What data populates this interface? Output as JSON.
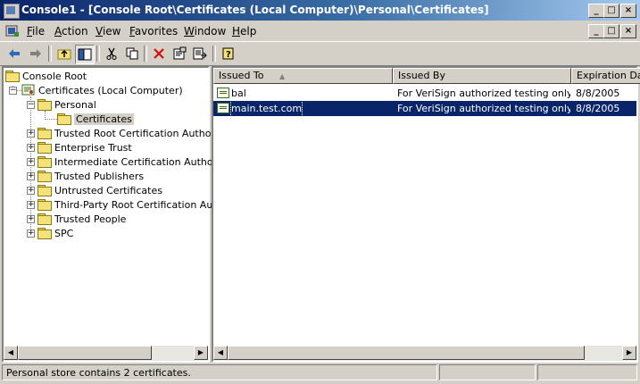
{
  "window": {
    "title": "Console1 - [Console Root\\Certificates (Local Computer)\\Personal\\Certificates]",
    "caption_buttons": [
      "_",
      "□",
      "×"
    ],
    "mdi_buttons": [
      "_",
      "□",
      "×"
    ]
  },
  "menu": {
    "items": [
      "File",
      "Action",
      "View",
      "Favorites",
      "Window",
      "Help"
    ]
  },
  "toolbar": {
    "buttons": [
      "back-arrow-icon",
      "forward-arrow-icon",
      "up-folder-icon",
      "show-hide-tree-icon",
      "cut-icon",
      "copy-icon",
      "delete-icon",
      "properties-icon",
      "export-list-icon",
      "help-icon"
    ]
  },
  "tree": {
    "nodes": [
      {
        "label": "Console Root"
      },
      {
        "label": "Certificates (Local Computer)"
      },
      {
        "label": "Personal"
      },
      {
        "label": "Certificates"
      },
      {
        "label": "Trusted Root Certification Authorities"
      },
      {
        "label": "Enterprise Trust"
      },
      {
        "label": "Intermediate Certification Authorities"
      },
      {
        "label": "Trusted Publishers"
      },
      {
        "label": "Untrusted Certificates"
      },
      {
        "label": "Third-Party Root Certification Authorities"
      },
      {
        "label": "Trusted People"
      },
      {
        "label": "SPC"
      }
    ]
  },
  "list": {
    "columns": [
      "Issued To",
      "Issued By",
      "Expiration Date"
    ],
    "sort_indicator": "▲",
    "rows": [
      {
        "issued_to": "bal",
        "issued_by": "For VeriSign authorized testing only....",
        "expiration": "8/8/2005"
      },
      {
        "issued_to": "main.test.com",
        "issued_by": "For VeriSign authorized testing only....",
        "expiration": "8/8/2005",
        "selected": true
      }
    ]
  },
  "status": {
    "text": "Personal store contains 2 certificates."
  },
  "colors": {
    "title_active": "#0a246a",
    "selection": "#0a246a",
    "face": "#d4d0c8"
  }
}
